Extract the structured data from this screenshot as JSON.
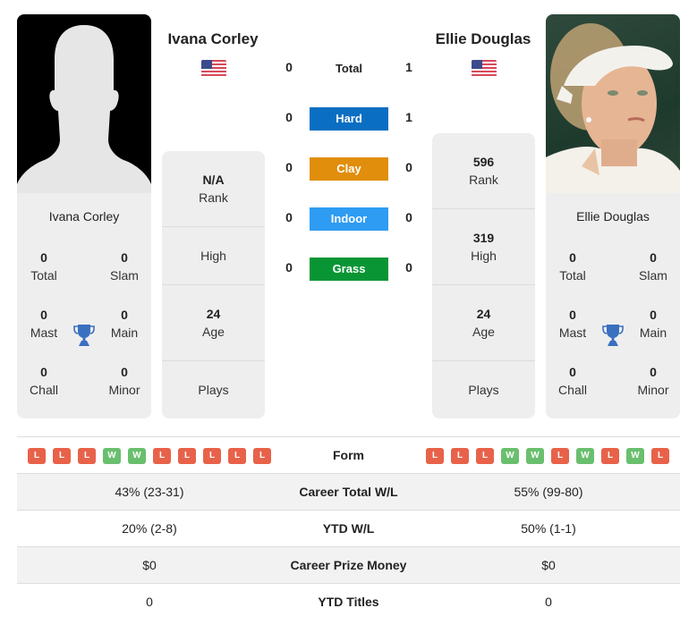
{
  "player_left": {
    "name": "Ivana Corley",
    "country_flag": "us-flag",
    "photo": "silhouette-placeholder",
    "titles": {
      "total": {
        "value": "0",
        "label": "Total"
      },
      "slam": {
        "value": "0",
        "label": "Slam"
      },
      "mast": {
        "value": "0",
        "label": "Mast"
      },
      "main": {
        "value": "0",
        "label": "Main"
      },
      "chall": {
        "value": "0",
        "label": "Chall"
      },
      "minor": {
        "value": "0",
        "label": "Minor"
      }
    },
    "stats": {
      "rank": {
        "value": "N/A",
        "label": "Rank"
      },
      "high": {
        "value": "",
        "label": "High"
      },
      "age": {
        "value": "24",
        "label": "Age"
      },
      "plays": {
        "value": "",
        "label": "Plays"
      }
    },
    "form": [
      "L",
      "L",
      "L",
      "W",
      "W",
      "L",
      "L",
      "L",
      "L",
      "L"
    ],
    "career_total_wl": "43% (23-31)",
    "ytd_wl": "20% (2-8)",
    "career_prize_money": "$0",
    "ytd_titles": "0"
  },
  "player_right": {
    "name": "Ellie Douglas",
    "country_flag": "us-flag",
    "photo": "player-photo",
    "titles": {
      "total": {
        "value": "0",
        "label": "Total"
      },
      "slam": {
        "value": "0",
        "label": "Slam"
      },
      "mast": {
        "value": "0",
        "label": "Mast"
      },
      "main": {
        "value": "0",
        "label": "Main"
      },
      "chall": {
        "value": "0",
        "label": "Chall"
      },
      "minor": {
        "value": "0",
        "label": "Minor"
      }
    },
    "stats": {
      "rank": {
        "value": "596",
        "label": "Rank"
      },
      "high": {
        "value": "319",
        "label": "High"
      },
      "age": {
        "value": "24",
        "label": "Age"
      },
      "plays": {
        "value": "",
        "label": "Plays"
      }
    },
    "form": [
      "L",
      "L",
      "L",
      "W",
      "W",
      "L",
      "W",
      "L",
      "W",
      "L"
    ],
    "career_total_wl": "55% (99-80)",
    "ytd_wl": "50% (1-1)",
    "career_prize_money": "$0",
    "ytd_titles": "0"
  },
  "h2h": {
    "total": {
      "label": "Total",
      "left": "0",
      "right": "1"
    },
    "surfaces": [
      {
        "label": "Hard",
        "left": "0",
        "right": "1",
        "color": "#0a6fc2"
      },
      {
        "label": "Clay",
        "left": "0",
        "right": "0",
        "color": "#e08e0b"
      },
      {
        "label": "Indoor",
        "left": "0",
        "right": "0",
        "color": "#2e9cf2"
      },
      {
        "label": "Grass",
        "left": "0",
        "right": "0",
        "color": "#0a9535"
      }
    ]
  },
  "comparison": {
    "form_label": "Form",
    "career_total_wl_label": "Career Total W/L",
    "ytd_wl_label": "YTD W/L",
    "career_prize_money_label": "Career Prize Money",
    "ytd_titles_label": "YTD Titles"
  },
  "colors": {
    "loss": "#e8624a",
    "win": "#6abf6e",
    "trophy": "#3a70c0",
    "panel_bg": "#eeeeee"
  }
}
